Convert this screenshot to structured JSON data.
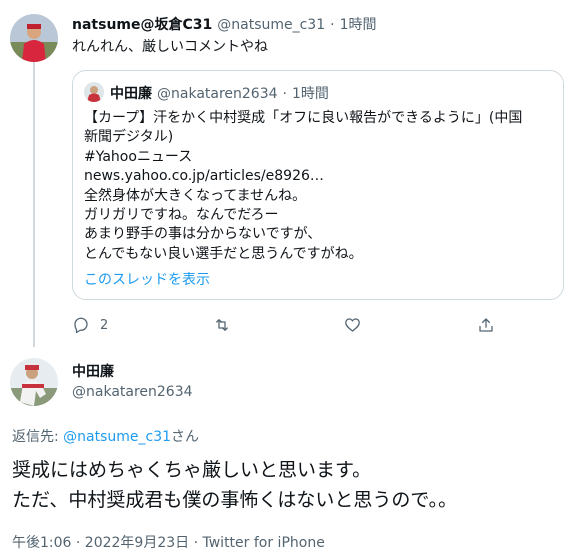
{
  "tweet1": {
    "name": "natsume@坂倉C31",
    "handle": "@natsume_c31",
    "sep": "·",
    "time": "1時間",
    "text": "れんれん、厳しいコメントやね"
  },
  "quote": {
    "name": "中田廉",
    "handle": "@nakataren2634",
    "sep": "·",
    "time": "1時間",
    "lines": [
      "【カープ】汗をかく中村奨成「オフに良い報告ができるように」(中国",
      "新聞デジタル)",
      "#Yahooニュース",
      "news.yahoo.co.jp/articles/e8926…",
      "全然身体が大きくなってませんね。",
      "ガリガリですね。なんでだろー",
      "あまり野手の事は分からないですが、",
      "とんでもない良い選手だと思うんですがね。"
    ],
    "show_thread": "このスレッドを表示"
  },
  "actions": {
    "reply_count": "2"
  },
  "tweet2": {
    "name": "中田廉",
    "handle": "@nakataren2634",
    "reply_prefix": "返信先: ",
    "reply_to": "@natsume_c31",
    "reply_suffix": "さん",
    "text_line1": "奨成にはめちゃくちゃ厳しいと思います。",
    "text_line2": "ただ、中村奨成君も僕の事怖くはないと思うので。。",
    "meta": "午後1:06 · 2022年9月23日 · Twitter for iPhone"
  },
  "colors": {
    "text": "#0f1419",
    "secondary": "#536471",
    "link": "#1d9bf0",
    "border": "#cfd9de"
  }
}
